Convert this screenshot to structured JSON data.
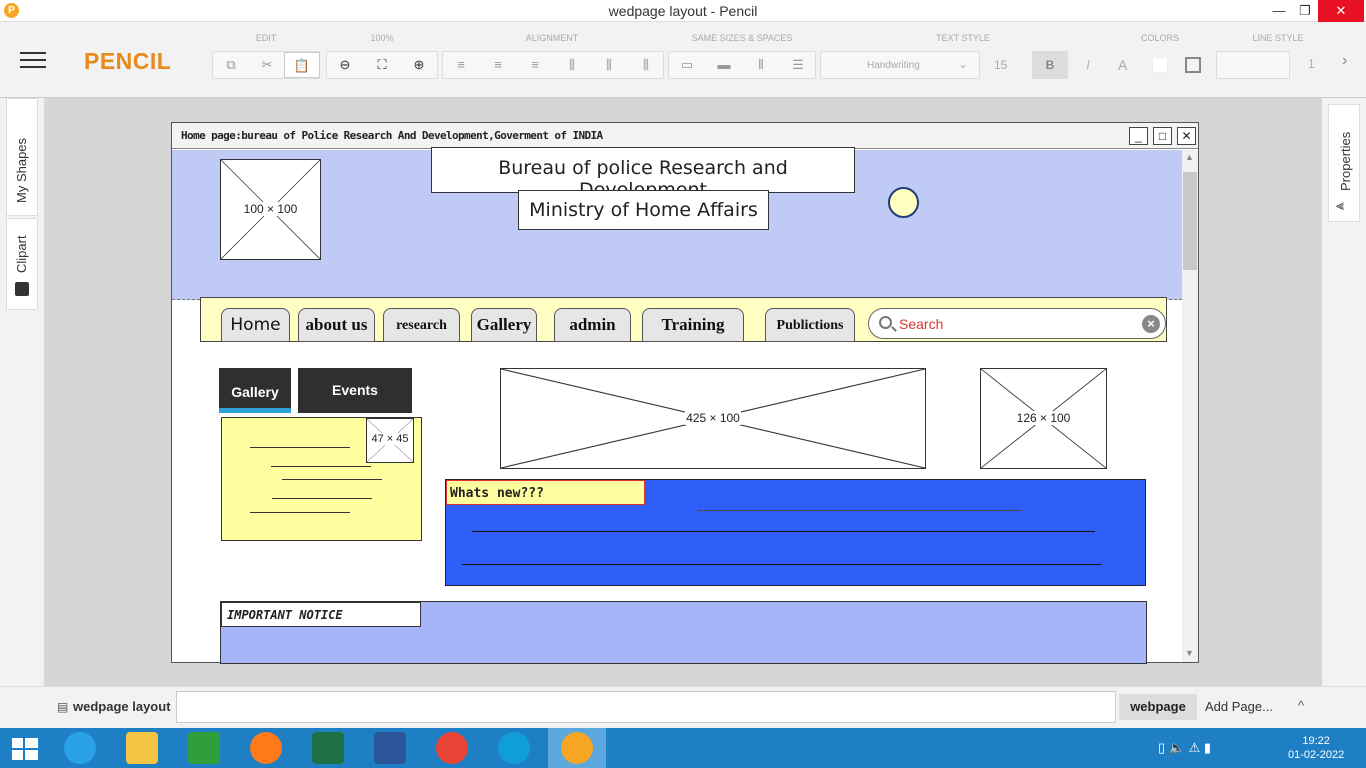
{
  "window": {
    "title": "wedpage layout - Pencil",
    "minimize": "—",
    "maximize": "❐",
    "close": "✕"
  },
  "toolbar": {
    "brand": "PENCIL",
    "groups": [
      "EDIT",
      "100%",
      "ALIGNMENT",
      "SAME SIZES & SPACES",
      "TEXT STYLE",
      "COLORS",
      "LINE STYLE"
    ],
    "font_family": "Handwriting",
    "font_size": "15",
    "bold": "B",
    "italic": "I",
    "color_a": "A",
    "line_width": "1",
    "more": "›"
  },
  "left_panel": {
    "tabs": [
      "My Shapes",
      "Clipart"
    ],
    "partial_tab": "hap"
  },
  "right_panel": {
    "tab": "Properties"
  },
  "mockup": {
    "title": "Home page:bureau of Police Research And Development,Goverment of INDIA",
    "header": {
      "logo_placeholder": "100 × 100",
      "org_name": "Bureau of police Research and Development",
      "ministry": "Ministry of Home Affairs"
    },
    "nav": [
      "Home",
      "about us",
      "research",
      "Gallery",
      "admin",
      "Training",
      "Publictions"
    ],
    "search_placeholder": "Search",
    "side_tabs": {
      "gallery": "Gallery",
      "events": "Events"
    },
    "note_placeholder": "47 × 45",
    "banner_placeholder": "425 × 100",
    "side_placeholder": "126 × 100",
    "whats_new": "Whats new???",
    "notice": "IMPORTANT NOTICE"
  },
  "pagebar": {
    "page_name": "wedpage layout",
    "active_page": "webpage",
    "add_page": "Add Page...",
    "collapse": "^"
  },
  "taskbar": {
    "time": "19:22",
    "date": "01-02-2022",
    "apps": [
      "Internet Explorer",
      "File Explorer",
      "Store",
      "Firefox",
      "Excel",
      "Word",
      "Chrome",
      "Edge",
      "Pencil"
    ]
  },
  "colors": {
    "accent": "#e8891a",
    "header_blue": "#bfcaf5",
    "nav_yellow": "#ffffc4",
    "whats_new_blue": "#2f5df7",
    "notice_blue": "#a5b5f7",
    "taskbar": "#1f7fc5"
  }
}
